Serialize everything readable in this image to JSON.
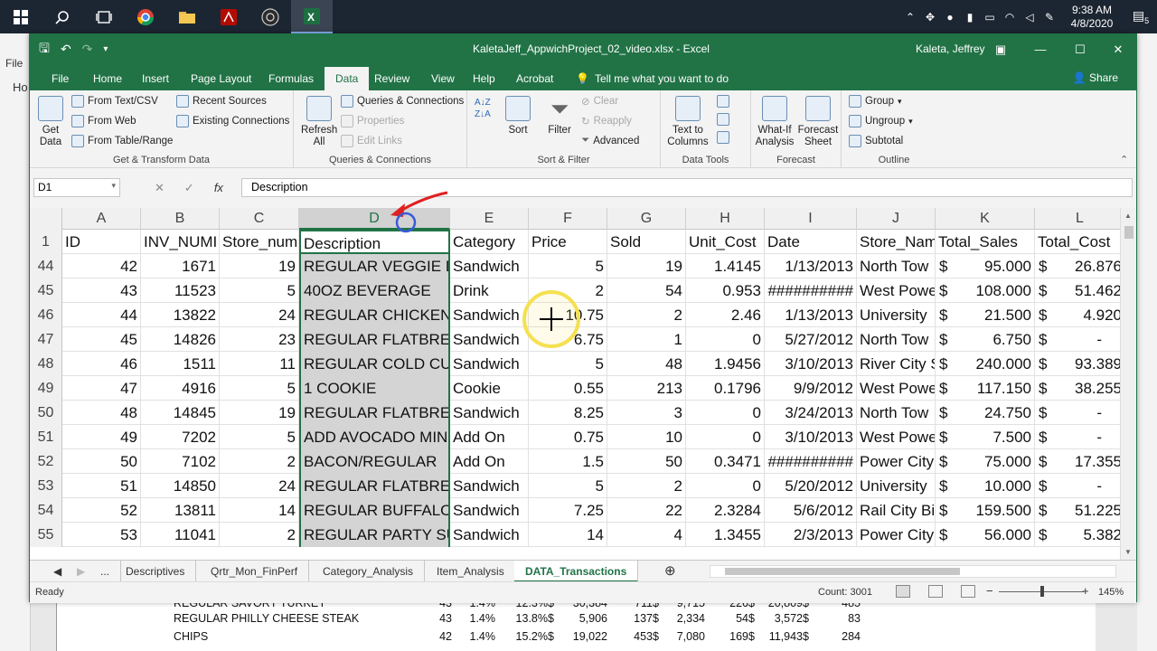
{
  "taskbar": {
    "time": "9:38 AM",
    "date": "4/8/2020",
    "notification_count": "5",
    "apps": [
      "start-icon",
      "search-icon",
      "task-view-icon",
      "chrome-icon",
      "file-explorer-icon",
      "acrobat-icon",
      "obs-icon",
      "excel-icon"
    ]
  },
  "background": {
    "left_file": "File",
    "left_ho": "Ho",
    "rows": [
      {
        "name": "REGULAR SAVORY TURKEY",
        "count": "43",
        "pct1": "1.4%",
        "pct2": "12.3%",
        "d1": "$",
        "v1": "30,384",
        "v2": "711",
        "d2": "$",
        "v3": "9,715",
        "v4": "226",
        "d3": "$",
        "v5": "20,809",
        "d4": "$",
        "v6": "485"
      },
      {
        "name": "REGULAR PHILLY CHEESE STEAK",
        "count": "43",
        "pct1": "1.4%",
        "pct2": "13.8%",
        "d1": "$",
        "v1": "5,906",
        "v2": "137",
        "d2": "$",
        "v3": "2,334",
        "v4": "54",
        "d3": "$",
        "v5": "3,572",
        "d4": "$",
        "v6": "83"
      },
      {
        "name": "CHIPS",
        "count": "42",
        "pct1": "1.4%",
        "pct2": "15.2%",
        "d1": "$",
        "v1": "19,022",
        "v2": "453",
        "d2": "$",
        "v3": "7,080",
        "v4": "169",
        "d3": "$",
        "v5": "11,943",
        "d4": "$",
        "v6": "284"
      }
    ]
  },
  "window": {
    "title": "KaletaJeff_AppwichProject_02_video.xlsx  -  Excel",
    "user": "Kaleta, Jeffrey",
    "share": "Share"
  },
  "tabs": [
    "File",
    "Home",
    "Insert",
    "Page Layout",
    "Formulas",
    "Data",
    "Review",
    "View",
    "Help",
    "Acrobat"
  ],
  "active_tab": "Data",
  "tell_me": "Tell me what you want to do",
  "ribbon": {
    "get_data": "Get Data",
    "get_data_l1": "Get",
    "get_data_l2": "Data",
    "from_text": "From Text/CSV",
    "from_web": "From Web",
    "from_table": "From Table/Range",
    "recent_sources": "Recent Sources",
    "existing_connections": "Existing Connections",
    "group_get_transform": "Get & Transform Data",
    "refresh_l1": "Refresh",
    "refresh_l2": "All",
    "queries_connections": "Queries & Connections",
    "properties": "Properties",
    "edit_links": "Edit Links",
    "group_queries": "Queries & Connections",
    "sort": "Sort",
    "filter": "Filter",
    "clear": "Clear",
    "reapply": "Reapply",
    "advanced": "Advanced",
    "group_sort_filter": "Sort & Filter",
    "text_to_columns_l1": "Text to",
    "text_to_columns_l2": "Columns",
    "group_data_tools": "Data Tools",
    "whatif_l1": "What-If",
    "whatif_l2": "Analysis",
    "forecast_l1": "Forecast",
    "forecast_l2": "Sheet",
    "group_forecast": "Forecast",
    "group": "Group",
    "ungroup": "Ungroup",
    "subtotal": "Subtotal",
    "group_outline": "Outline"
  },
  "formula_bar": {
    "name_box": "D1",
    "formula": "Description"
  },
  "columns": [
    "A",
    "B",
    "C",
    "D",
    "E",
    "F",
    "G",
    "H",
    "I",
    "J",
    "K",
    "L"
  ],
  "selected_column": "D",
  "header_row": {
    "row": "1",
    "cells": [
      "ID",
      "INV_NUMI",
      "Store_num",
      "Description",
      "Category",
      "Price",
      "Sold",
      "Unit_Cost",
      "Date",
      "Store_Nam",
      "Total_Sales",
      "Total_Cost"
    ]
  },
  "rows": [
    {
      "row": "44",
      "A": "42",
      "B": "1671",
      "C": "19",
      "D": "REGULAR VEGGIE DE",
      "E": "Sandwich",
      "F": "5",
      "G": "19",
      "H": "1.4145",
      "I": "1/13/2013",
      "J": "North Tow",
      "K": "95.000",
      "L": "26.876"
    },
    {
      "row": "45",
      "A": "43",
      "B": "11523",
      "C": "5",
      "D": "40OZ BEVERAGE",
      "E": "Drink",
      "F": "2",
      "G": "54",
      "H": "0.953",
      "I": "##########",
      "J": "West Powe",
      "K": "108.000",
      "L": "51.462"
    },
    {
      "row": "46",
      "A": "44",
      "B": "13822",
      "C": "24",
      "D": "REGULAR CHICKEN T",
      "E": "Sandwich",
      "F": "10.75",
      "G": "2",
      "H": "2.46",
      "I": "1/13/2013",
      "J": "University",
      "K": "21.500",
      "L": "4.920"
    },
    {
      "row": "47",
      "A": "45",
      "B": "14826",
      "C": "23",
      "D": "REGULAR FLATBREAI",
      "E": "Sandwich",
      "F": "6.75",
      "G": "1",
      "H": "0",
      "I": "5/27/2012",
      "J": "North Tow",
      "K": "6.750",
      "L": "-"
    },
    {
      "row": "48",
      "A": "46",
      "B": "1511",
      "C": "11",
      "D": "REGULAR COLD CUT",
      "E": "Sandwich",
      "F": "5",
      "G": "48",
      "H": "1.9456",
      "I": "3/10/2013",
      "J": "River City S",
      "K": "240.000",
      "L": "93.389"
    },
    {
      "row": "49",
      "A": "47",
      "B": "4916",
      "C": "5",
      "D": "1 COOKIE",
      "E": "Cookie",
      "F": "0.55",
      "G": "213",
      "H": "0.1796",
      "I": "9/9/2012",
      "J": "West Powe",
      "K": "117.150",
      "L": "38.255"
    },
    {
      "row": "50",
      "A": "48",
      "B": "14845",
      "C": "19",
      "D": "REGULAR FLATBREAI",
      "E": "Sandwich",
      "F": "8.25",
      "G": "3",
      "H": "0",
      "I": "3/24/2013",
      "J": "North Tow",
      "K": "24.750",
      "L": "-"
    },
    {
      "row": "51",
      "A": "49",
      "B": "7202",
      "C": "5",
      "D": "ADD AVOCADO MIN",
      "E": "Add On",
      "F": "0.75",
      "G": "10",
      "H": "0",
      "I": "3/10/2013",
      "J": "West Powe",
      "K": "7.500",
      "L": "-"
    },
    {
      "row": "52",
      "A": "50",
      "B": "7102",
      "C": "2",
      "D": "BACON/REGULAR",
      "E": "Add On",
      "F": "1.5",
      "G": "50",
      "H": "0.3471",
      "I": "##########",
      "J": "Power City",
      "K": "75.000",
      "L": "17.355"
    },
    {
      "row": "53",
      "A": "51",
      "B": "14850",
      "C": "24",
      "D": "REGULAR FLATBREAI",
      "E": "Sandwich",
      "F": "5",
      "G": "2",
      "H": "0",
      "I": "5/20/2012",
      "J": "University",
      "K": "10.000",
      "L": "-"
    },
    {
      "row": "54",
      "A": "52",
      "B": "13811",
      "C": "14",
      "D": "REGULAR BUFFALO C",
      "E": "Sandwich",
      "F": "7.25",
      "G": "22",
      "H": "2.3284",
      "I": "5/6/2012",
      "J": "Rail City Bi",
      "K": "159.500",
      "L": "51.225"
    },
    {
      "row": "55",
      "A": "53",
      "B": "11041",
      "C": "2",
      "D": "REGULAR PARTY SUE",
      "E": "Sandwich",
      "F": "14",
      "G": "4",
      "H": "1.3455",
      "I": "2/3/2013",
      "J": "Power City",
      "K": "56.000",
      "L": "5.382"
    }
  ],
  "currency_symbol": "$",
  "sheets": [
    "...",
    "Descriptives",
    "Qrtr_Mon_FinPerf",
    "Category_Analysis",
    "Item_Analysis",
    "DATA_Transactions"
  ],
  "active_sheet": "DATA_Transactions",
  "status": {
    "mode": "Ready",
    "count": "Count: 3001",
    "zoom": "145%"
  },
  "colors": {
    "excel_green": "#217346",
    "annotation_red": "#e02020",
    "annotation_blue": "#3a5bd9",
    "highlight_yellow": "#f5e050"
  }
}
